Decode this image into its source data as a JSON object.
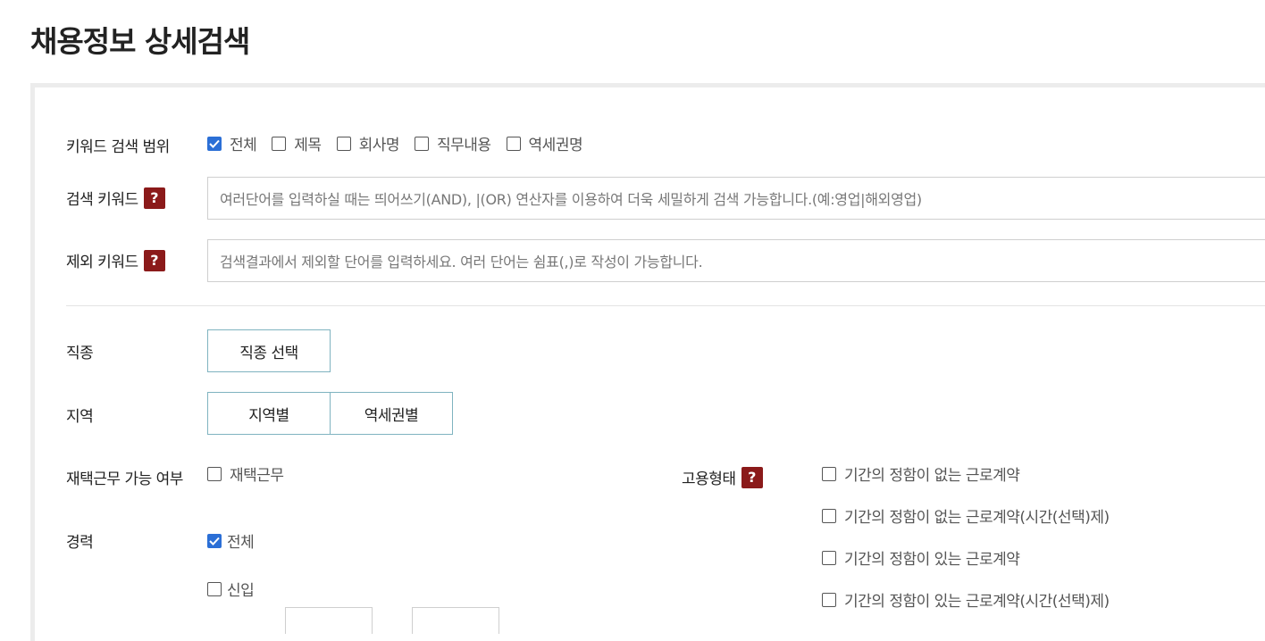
{
  "page_title": "채용정보 상세검색",
  "colors": {
    "accent_check": "#2b6fd6",
    "help_icon": "#8b1a1a",
    "button_border": "#7fb3c0"
  },
  "keyword_scope": {
    "label": "키워드 검색 범위",
    "options": [
      {
        "label": "전체",
        "checked": true
      },
      {
        "label": "제목",
        "checked": false
      },
      {
        "label": "회사명",
        "checked": false
      },
      {
        "label": "직무내용",
        "checked": false
      },
      {
        "label": "역세권명",
        "checked": false
      }
    ]
  },
  "search_keyword": {
    "label": "검색 키워드",
    "help": "?",
    "placeholder": "여러단어를 입력하실 때는 띄어쓰기(AND), |(OR) 연산자를 이용하여 더욱 세밀하게 검색 가능합니다.(예:영업|해외영업)"
  },
  "exclude_keyword": {
    "label": "제외 키워드",
    "help": "?",
    "placeholder": "검색결과에서 제외할 단어를 입력하세요. 여러 단어는 쉼표(,)로 작성이 가능합니다."
  },
  "job_type": {
    "label": "직종",
    "button": "직종 선택"
  },
  "region": {
    "label": "지역",
    "buttons": [
      "지역별",
      "역세권별"
    ]
  },
  "remote": {
    "label": "재택근무 가능 여부",
    "option": {
      "label": "재택근무",
      "checked": false
    }
  },
  "career": {
    "label": "경력",
    "options": [
      {
        "label": "전체",
        "checked": true
      },
      {
        "label": "신입",
        "checked": false
      }
    ]
  },
  "employment_type": {
    "label": "고용형태",
    "help": "?",
    "options": [
      {
        "label": "기간의 정함이 없는 근로계약",
        "checked": false
      },
      {
        "label": "기간의 정함이 없는 근로계약(시간(선택)제)",
        "checked": false
      },
      {
        "label": "기간의 정함이 있는 근로계약",
        "checked": false
      },
      {
        "label": "기간의 정함이 있는 근로계약(시간(선택)제)",
        "checked": false
      }
    ]
  }
}
